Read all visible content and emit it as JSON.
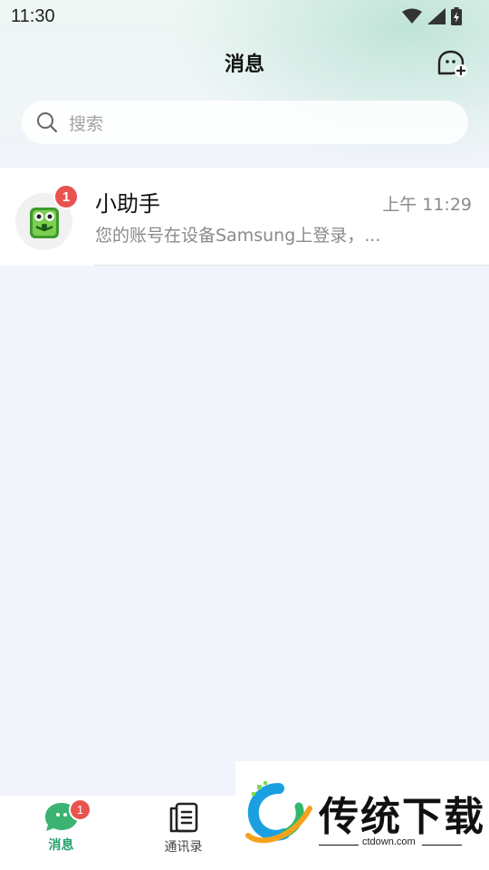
{
  "status_bar": {
    "time": "11:30"
  },
  "header": {
    "title": "消息"
  },
  "search": {
    "placeholder": "搜索"
  },
  "conversations": [
    {
      "name": "小助手",
      "time": "上午 11:29",
      "preview": "您的账号在设备Samsung上登录，...",
      "unread": "1"
    }
  ],
  "tab_bar": {
    "tabs": [
      {
        "label": "消息",
        "badge": "1",
        "active": true
      },
      {
        "label": "通讯录",
        "active": false
      }
    ]
  },
  "watermark": {
    "title": "传统下载",
    "url": "ctdown.com"
  },
  "colors": {
    "accent": "#23a06a",
    "badge": "#e8534f"
  }
}
